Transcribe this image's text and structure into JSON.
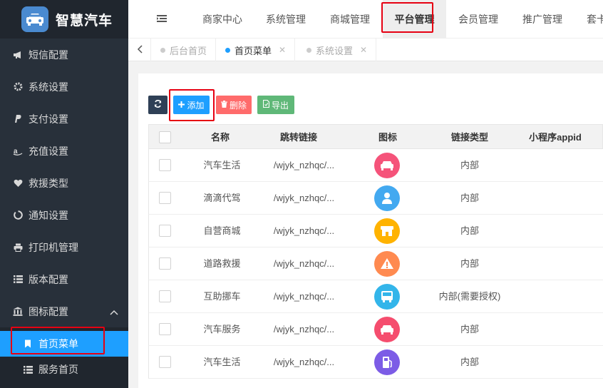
{
  "app": {
    "title": "智慧汽车"
  },
  "sidebar": {
    "items": [
      {
        "label": "短信配置",
        "icon": "bullhorn-icon"
      },
      {
        "label": "系统设置",
        "icon": "gear-icon"
      },
      {
        "label": "支付设置",
        "icon": "paypal-icon"
      },
      {
        "label": "充值设置",
        "icon": "amazon-icon"
      },
      {
        "label": "救援类型",
        "icon": "heart-icon"
      },
      {
        "label": "通知设置",
        "icon": "circle-notch-icon"
      },
      {
        "label": "打印机管理",
        "icon": "printer-icon"
      },
      {
        "label": "版本配置",
        "icon": "list-icon"
      },
      {
        "label": "图标配置",
        "icon": "bank-icon"
      }
    ],
    "sub_items": [
      {
        "label": "首页菜单",
        "icon": "bookmark-icon",
        "active": true
      },
      {
        "label": "服务首页",
        "icon": "list-icon",
        "active": false
      }
    ]
  },
  "topnav": {
    "items": [
      "商家中心",
      "系统管理",
      "商城管理",
      "平台管理",
      "会员管理",
      "推广管理",
      "套卡"
    ],
    "active": "平台管理"
  },
  "tabs": [
    {
      "label": "后台首页",
      "closable": false,
      "active": false
    },
    {
      "label": "首页菜单",
      "closable": true,
      "active": true
    },
    {
      "label": "系统设置",
      "closable": true,
      "active": false
    }
  ],
  "toolbar": {
    "add_label": "添加",
    "delete_label": "删除",
    "export_label": "导出"
  },
  "table": {
    "headers": [
      "名称",
      "跳转链接",
      "图标",
      "链接类型",
      "小程序appid"
    ],
    "rows": [
      {
        "name": "汽车生活",
        "link": "/wjyk_nzhqc/...",
        "link_type": "内部",
        "icon": "car-icon",
        "color": "#f5537a"
      },
      {
        "name": "滴滴代驾",
        "link": "/wjyk_nzhqc/...",
        "link_type": "内部",
        "icon": "driver-icon",
        "color": "#43a9f0"
      },
      {
        "name": "自营商城",
        "link": "/wjyk_nzhqc/...",
        "link_type": "内部",
        "icon": "shop-icon",
        "color": "#ffb300"
      },
      {
        "name": "道路救援",
        "link": "/wjyk_nzhqc/...",
        "link_type": "内部",
        "icon": "warning-icon",
        "color": "#ff8a50"
      },
      {
        "name": "互助挪车",
        "link": "/wjyk_nzhqc/...",
        "link_type": "内部(需要授权)",
        "icon": "bus-icon",
        "color": "#33b5ea"
      },
      {
        "name": "汽车服务",
        "link": "/wjyk_nzhqc/...",
        "link_type": "内部",
        "icon": "car-icon",
        "color": "#f54d6e"
      },
      {
        "name": "汽车生活",
        "link": "/wjyk_nzhqc/...",
        "link_type": "内部",
        "icon": "fuel-icon",
        "color": "#7c5ce6"
      }
    ]
  },
  "colors": {
    "accent": "#1e9fff",
    "sidebar_bg": "#28303a",
    "highlight": "#e60012",
    "danger": "#ff6b6b",
    "success": "#5fb878"
  }
}
